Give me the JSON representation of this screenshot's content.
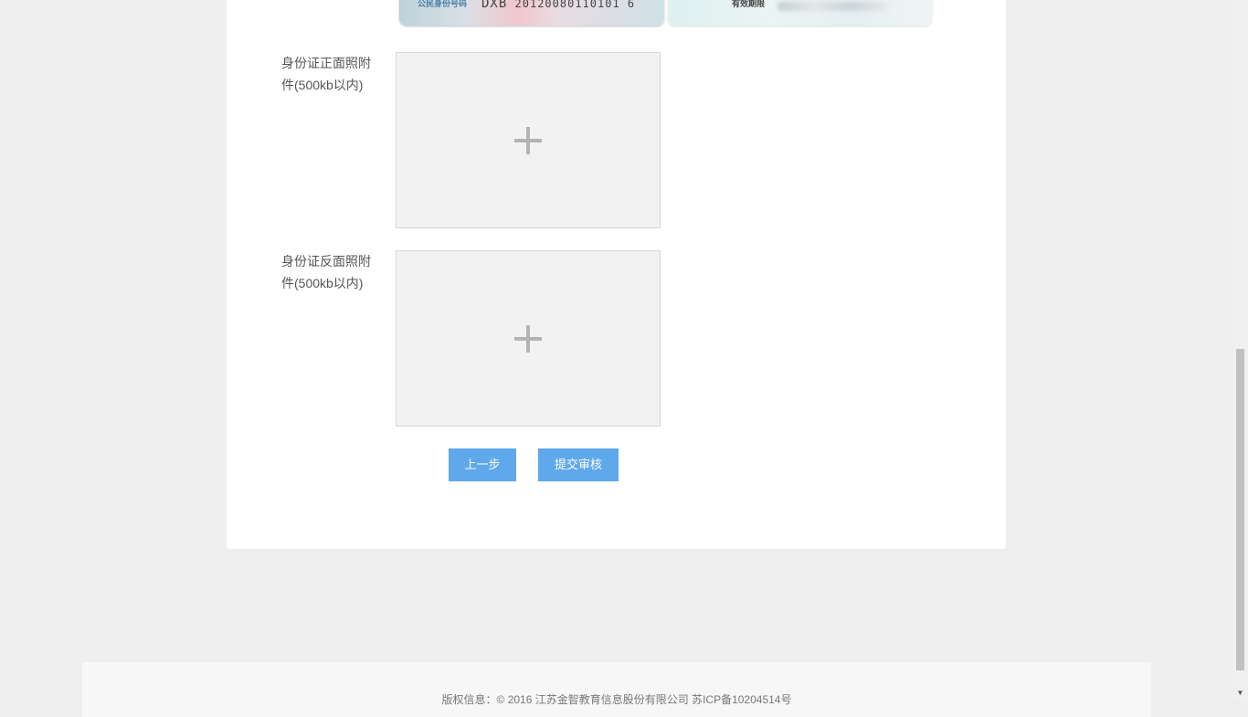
{
  "samples": {
    "front": {
      "label": "公民身份号码",
      "number_prefix": "DXB",
      "number_rest": "20120080110101 6"
    },
    "back": {
      "label": "有效期限"
    }
  },
  "upload": {
    "front_label": "身份证正面照附件(500kb以内)",
    "back_label": "身份证反面照附件(500kb以内)"
  },
  "buttons": {
    "prev": "上一步",
    "submit": "提交审核"
  },
  "footer": {
    "copyright": "版权信息：© 2016 江苏金智教育信息股份有限公司 苏ICP备10204514号"
  },
  "colors": {
    "button": "#5fa8ec",
    "background": "#eeeeee",
    "card": "#ffffff"
  }
}
